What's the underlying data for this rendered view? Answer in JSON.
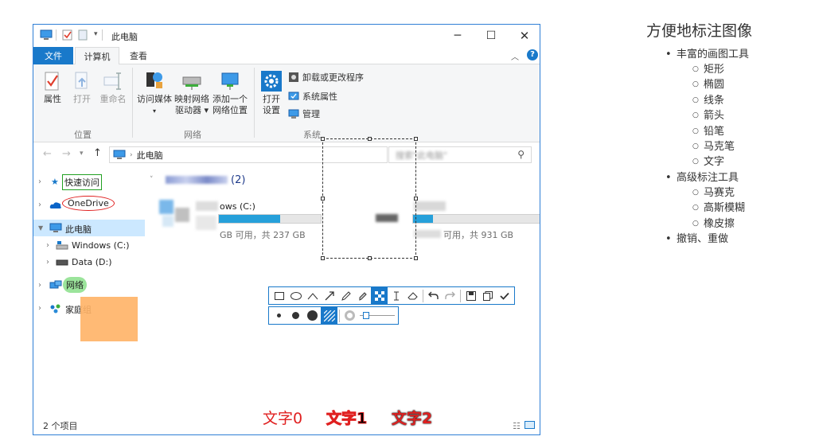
{
  "window": {
    "title": "此电脑",
    "tabs": {
      "file": "文件",
      "computer": "计算机",
      "view": "查看"
    },
    "ribbon": {
      "location": {
        "label": "位置",
        "properties": "属性",
        "open": "打开",
        "rename": "重命名"
      },
      "network": {
        "label": "网络",
        "access_media": "访问媒体",
        "map_drive_1": "映射网络",
        "map_drive_2": "驱动器",
        "add_location_1": "添加一个",
        "add_location_2": "网络位置"
      },
      "system": {
        "label": "系统",
        "open_settings_1": "打开",
        "open_settings_2": "设置",
        "uninstall": "卸载或更改程序",
        "system_properties": "系统属性",
        "manage": "管理"
      }
    },
    "address": {
      "path": "此电脑",
      "search_placeholder": "搜索\"此电脑\""
    },
    "nav": {
      "quick_access": "快速访问",
      "onedrive": "OneDrive",
      "this_pc": "此电脑",
      "windows_c": "Windows (C:)",
      "data_d": "Data (D:)",
      "network": "网络",
      "homegroup": "家庭组"
    },
    "content": {
      "group_header": "(2)",
      "drive_c": {
        "name": "ows (C:)",
        "info": "GB 可用，共 237 GB",
        "used_fraction": 0.6
      },
      "drive_d": {
        "info": "可用，共 931 GB",
        "used_fraction": 0.15
      }
    },
    "status": {
      "count": "2 个项目"
    }
  },
  "annotations": {
    "text_samples": [
      "文字0",
      "文字1",
      "文字2"
    ],
    "colors": {
      "red": "#e02020",
      "green": "#22a022",
      "orange": "#ffb366",
      "accent": "#1979ca"
    },
    "toolbar_tools": [
      "rectangle-icon",
      "ellipse-icon",
      "polyline-icon",
      "arrow-icon",
      "pencil-icon",
      "marker-icon",
      "mosaic-icon",
      "text-cursor-icon",
      "eraser-icon",
      "undo-icon",
      "redo-icon",
      "save-icon",
      "copy-icon",
      "check-icon"
    ],
    "active_tool": "mosaic-icon"
  },
  "notes": {
    "title": "方便地标注图像",
    "rich_tools": "丰富的画图工具",
    "rich_items": [
      "矩形",
      "椭圆",
      "线条",
      "箭头",
      "铅笔",
      "马克笔",
      "文字"
    ],
    "advanced_tools": "高级标注工具",
    "advanced_items": [
      "马赛克",
      "高斯模糊",
      "橡皮擦"
    ],
    "undo_redo": "撤销、重做"
  }
}
